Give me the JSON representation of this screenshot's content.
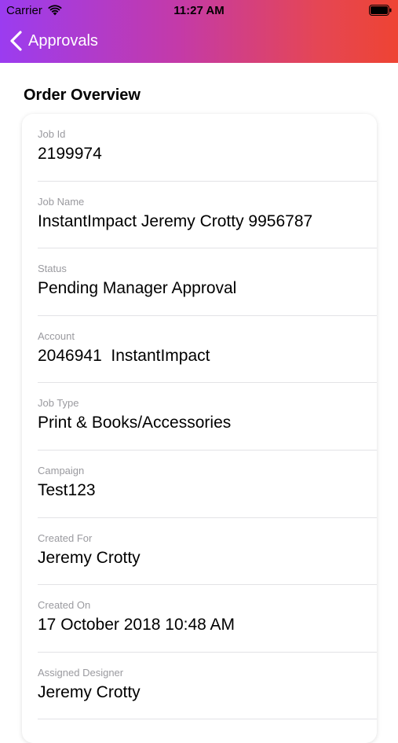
{
  "status_bar": {
    "carrier": "Carrier",
    "time": "11:27 AM"
  },
  "nav": {
    "back_label": "Approvals"
  },
  "section": {
    "title": "Order Overview"
  },
  "fields": [
    {
      "label": "Job Id",
      "value": "2199974"
    },
    {
      "label": "Job Name",
      "value": "InstantImpact Jeremy Crotty 9956787"
    },
    {
      "label": "Status",
      "value": "Pending Manager Approval"
    },
    {
      "label": "Account",
      "value": "2046941  InstantImpact"
    },
    {
      "label": "Job Type",
      "value": "Print & Books/Accessories"
    },
    {
      "label": "Campaign",
      "value": "Test123"
    },
    {
      "label": "Created For",
      "value": "Jeremy Crotty"
    },
    {
      "label": "Created On",
      "value": "17 October 2018 10:48 AM"
    },
    {
      "label": "Assigned Designer",
      "value": "Jeremy Crotty"
    }
  ],
  "colors": {
    "header_gradient_start": "#9b3cf0",
    "header_gradient_end": "#ee4433",
    "label": "#9a9a9f",
    "value": "#000000"
  },
  "icons": {
    "wifi": "wifi-icon",
    "battery": "battery-icon",
    "back": "chevron-left-icon"
  }
}
